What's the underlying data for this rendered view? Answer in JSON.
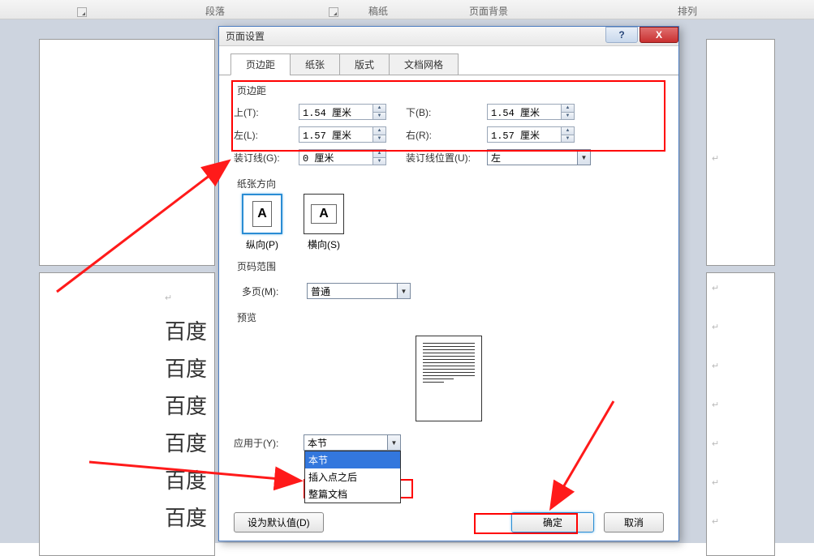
{
  "ribbon": {
    "group_paragraph": "段落",
    "group_paper": "稿纸",
    "group_pagebg": "页面背景",
    "group_arrange": "排列"
  },
  "document": {
    "text_line": "百度"
  },
  "dialog": {
    "title": "页面设置",
    "help_label": "?",
    "close_label": "X",
    "tabs": {
      "margin": "页边距",
      "paper": "纸张",
      "layout": "版式",
      "grid": "文档网格"
    },
    "margins": {
      "legend": "页边距",
      "top_label": "上(T):",
      "top_value": "1.54 厘米",
      "bottom_label": "下(B):",
      "bottom_value": "1.54 厘米",
      "left_label": "左(L):",
      "left_value": "1.57 厘米",
      "right_label": "右(R):",
      "right_value": "1.57 厘米",
      "gutter_label": "装订线(G):",
      "gutter_value": "0 厘米",
      "gutter_pos_label": "装订线位置(U):",
      "gutter_pos_value": "左"
    },
    "orientation": {
      "legend": "纸张方向",
      "portrait_symbol": "A",
      "portrait_label": "纵向(P)",
      "landscape_symbol": "A",
      "landscape_label": "横向(S)"
    },
    "pages": {
      "legend": "页码范围",
      "multi_label": "多页(M):",
      "multi_value": "普通"
    },
    "preview": {
      "legend": "预览"
    },
    "apply": {
      "label": "应用于(Y):",
      "value": "本节",
      "options": {
        "this_section": "本节",
        "after_insert": "插入点之后",
        "whole_doc": "整篇文档"
      }
    },
    "buttons": {
      "default": "设为默认值(D)",
      "ok": "确定",
      "cancel": "取消"
    }
  }
}
